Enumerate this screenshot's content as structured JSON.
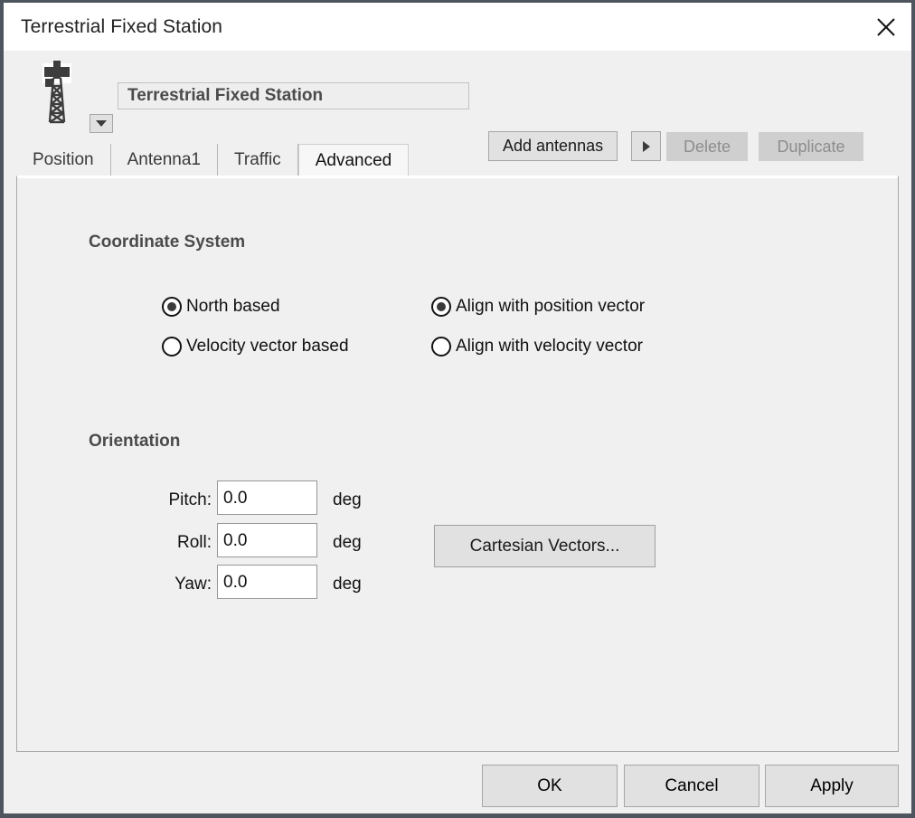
{
  "window": {
    "title": "Terrestrial Fixed Station",
    "close_icon": "close-icon"
  },
  "header": {
    "icon": "radio-tower-icon",
    "icon_dropdown": "chevron-down-icon",
    "name_value": "Terrestrial Fixed Station",
    "add_antennas_label": "Add antennas",
    "add_antennas_arrow_icon": "triangle-right-icon",
    "delete_label": "Delete",
    "delete_enabled": false,
    "duplicate_label": "Duplicate",
    "duplicate_enabled": false
  },
  "tabs": [
    {
      "label": "Position",
      "active": false
    },
    {
      "label": "Antenna1",
      "active": false
    },
    {
      "label": "Traffic",
      "active": false
    },
    {
      "label": "Advanced",
      "active": true
    }
  ],
  "coordinate_system": {
    "title": "Coordinate System",
    "left_group": [
      {
        "label": "North based",
        "checked": true
      },
      {
        "label": "Velocity vector based",
        "checked": false
      }
    ],
    "right_group": [
      {
        "label": "Align with position vector",
        "checked": true
      },
      {
        "label": "Align with velocity vector",
        "checked": false
      }
    ]
  },
  "orientation": {
    "title": "Orientation",
    "fields": [
      {
        "label": "Pitch:",
        "value": "0.0",
        "unit": "deg"
      },
      {
        "label": "Roll:",
        "value": "0.0",
        "unit": "deg"
      },
      {
        "label": "Yaw:",
        "value": "0.0",
        "unit": "deg"
      }
    ],
    "cartesian_button_label": "Cartesian Vectors..."
  },
  "footer": {
    "ok_label": "OK",
    "cancel_label": "Cancel",
    "apply_label": "Apply"
  },
  "colors": {
    "window_chrome": "#4e555f",
    "dialog_background": "#f0f0f0",
    "titlebar_background": "#ffffff",
    "button_face": "#e1e1e1",
    "button_disabled_face": "#cfcfcf",
    "button_disabled_text": "#8d8d8d",
    "input_background": "#ffffff",
    "section_title_text": "#4b4b4b",
    "body_text": "#111111"
  }
}
